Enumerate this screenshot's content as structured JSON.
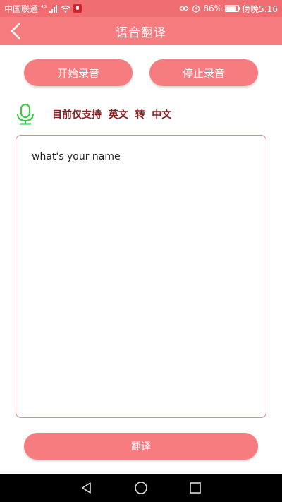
{
  "status_bar": {
    "carrier": "中国联通",
    "network": "⁴ᴳ",
    "battery_percent": "86%",
    "battery_level": 0.86,
    "time": "傍晚5:16"
  },
  "app_bar": {
    "title": "语音翻译"
  },
  "controls": {
    "start_label": "开始录音",
    "stop_label": "停止录音"
  },
  "info": {
    "support_text": "目前仅支持  英文  转  中文"
  },
  "transcript": {
    "value": "what's your name"
  },
  "translate": {
    "label": "翻译"
  },
  "colors": {
    "status_bar": "#f06d72",
    "app_bar": "#f67c80",
    "button": "#f67c80",
    "mic": "#3ec84a",
    "info_text": "#8c1d1d",
    "text_border": "#e4868a"
  }
}
